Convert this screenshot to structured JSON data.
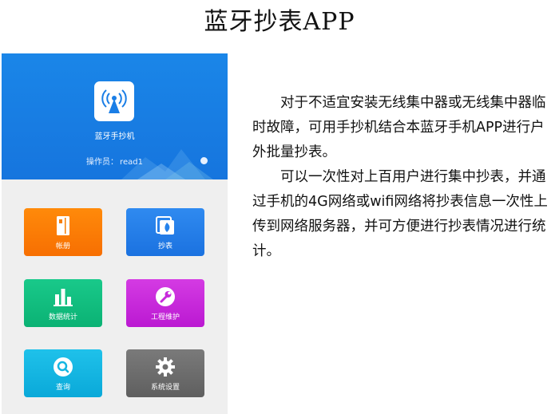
{
  "title": "蓝牙抄表APP",
  "app": {
    "name": "蓝牙手抄机",
    "operator_label": "操作员：",
    "operator_value": "read1"
  },
  "tiles": [
    {
      "label": "帐册",
      "icon": "ledger-icon",
      "color": "#f77f05"
    },
    {
      "label": "抄表",
      "icon": "meter-reading-icon",
      "color": "#2583ec"
    },
    {
      "label": "数据统计",
      "icon": "bar-chart-icon",
      "color": "#12c07f"
    },
    {
      "label": "工程维护",
      "icon": "wrench-icon",
      "color": "#c72adb"
    },
    {
      "label": "查询",
      "icon": "search-icon",
      "color": "#15b6e2"
    },
    {
      "label": "系统设置",
      "icon": "gear-icon",
      "color": "#6d6d6d"
    }
  ],
  "description": {
    "para1": "　　对于不适宜安装无线集中器或无线集中器临时故障，可用手抄机结合本蓝牙手机APP进行户外批量抄表。",
    "para2": "　　可以一次性对上百用户进行集中抄表，并通过手机的4G网络或wifi网络将抄表信息一次性上传到网络服务器，并可方便进行抄表情况进行统计。"
  }
}
